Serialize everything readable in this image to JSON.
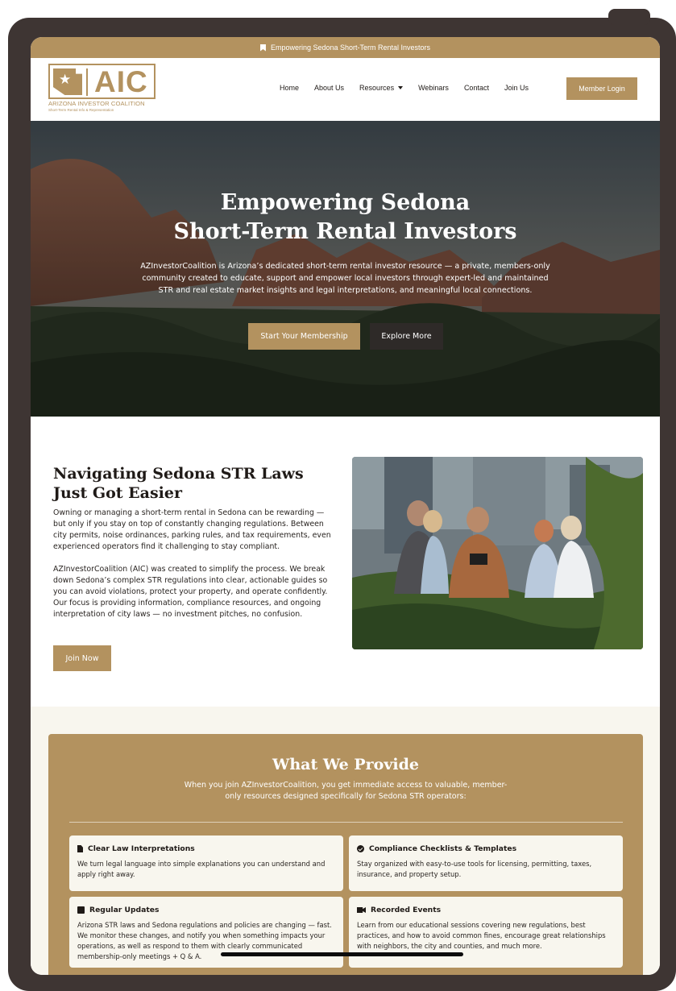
{
  "topbar": {
    "text": "Empowering Sedona Short-Term Rental Investors",
    "icon": "bookmark-icon"
  },
  "logo": {
    "abbr": "AIC",
    "name": "ARIZONA INVESTOR COALITION",
    "tagline": "Short-Term Rental Info & Representation",
    "icon": "arizona-state-star-icon"
  },
  "nav": {
    "items": [
      {
        "label": "Home"
      },
      {
        "label": "About Us"
      },
      {
        "label": "Resources",
        "dropdown": true
      },
      {
        "label": "Webinars"
      },
      {
        "label": "Contact"
      },
      {
        "label": "Join Us"
      }
    ],
    "login": "Member Login"
  },
  "hero": {
    "title_line1": "Empowering Sedona",
    "title_line2": "Short-Term Rental Investors",
    "text": "AZInvestorCoalition is Arizona’s dedicated short-term rental investor resource — a private, members-only community created to educate, support and empower local investors through expert-led and maintained STR and real estate market insights and legal interpretations, and meaningful local connections.",
    "primary_button": "Start Your Membership",
    "secondary_button": "Explore More"
  },
  "intro": {
    "title_line1": "Navigating Sedona STR Laws",
    "title_line2": "Just Got Easier",
    "p1": "Owning or managing a short-term rental in Sedona can be rewarding — but only if you stay on top of constantly changing regulations. Between city permits, noise ordinances, parking rules, and tax requirements, even experienced operators find it challenging to stay compliant.",
    "p2": "AZInvestorCoalition (AIC) was created to simplify the process. We break down Sedona’s complex STR regulations into clear, actionable guides so you can avoid violations, protect your property, and operate confidently. Our focus is providing information, compliance resources, and ongoing interpretation of city laws — no investment pitches, no confusion.",
    "button": "Join Now"
  },
  "provide": {
    "title": "What We Provide",
    "subtitle": "When you join AZInvestorCoalition, you get immediate access to valuable, member-only resources designed specifically for Sedona STR operators:",
    "cards": [
      {
        "icon": "document-icon",
        "title": "Clear Law Interpretations",
        "text": "We turn legal language into simple explanations you can understand and apply right away."
      },
      {
        "icon": "check-circle-icon",
        "title": "Compliance Checklists & Templates",
        "text": "Stay organized with easy-to-use tools for licensing, permitting, taxes, insurance, and property setup."
      },
      {
        "icon": "calendar-icon",
        "title": "Regular Updates",
        "text": "Arizona STR laws and Sedona regulations and policies are changing — fast. We monitor these changes, and notify you when something impacts your operations, as well as respond to them with clearly communicated membership-only meetings + Q & A."
      },
      {
        "icon": "video-camera-icon",
        "title": "Recorded Events",
        "text": "Learn from our educational sessions covering new regulations, best practices, and how to avoid common fines, encourage great relationships with neighbors, the city and counties, and much more."
      }
    ]
  },
  "colors": {
    "brand": "#b3925f",
    "dark": "#2e2a28",
    "frame": "#3e3533",
    "cream": "#f8f6ee"
  }
}
